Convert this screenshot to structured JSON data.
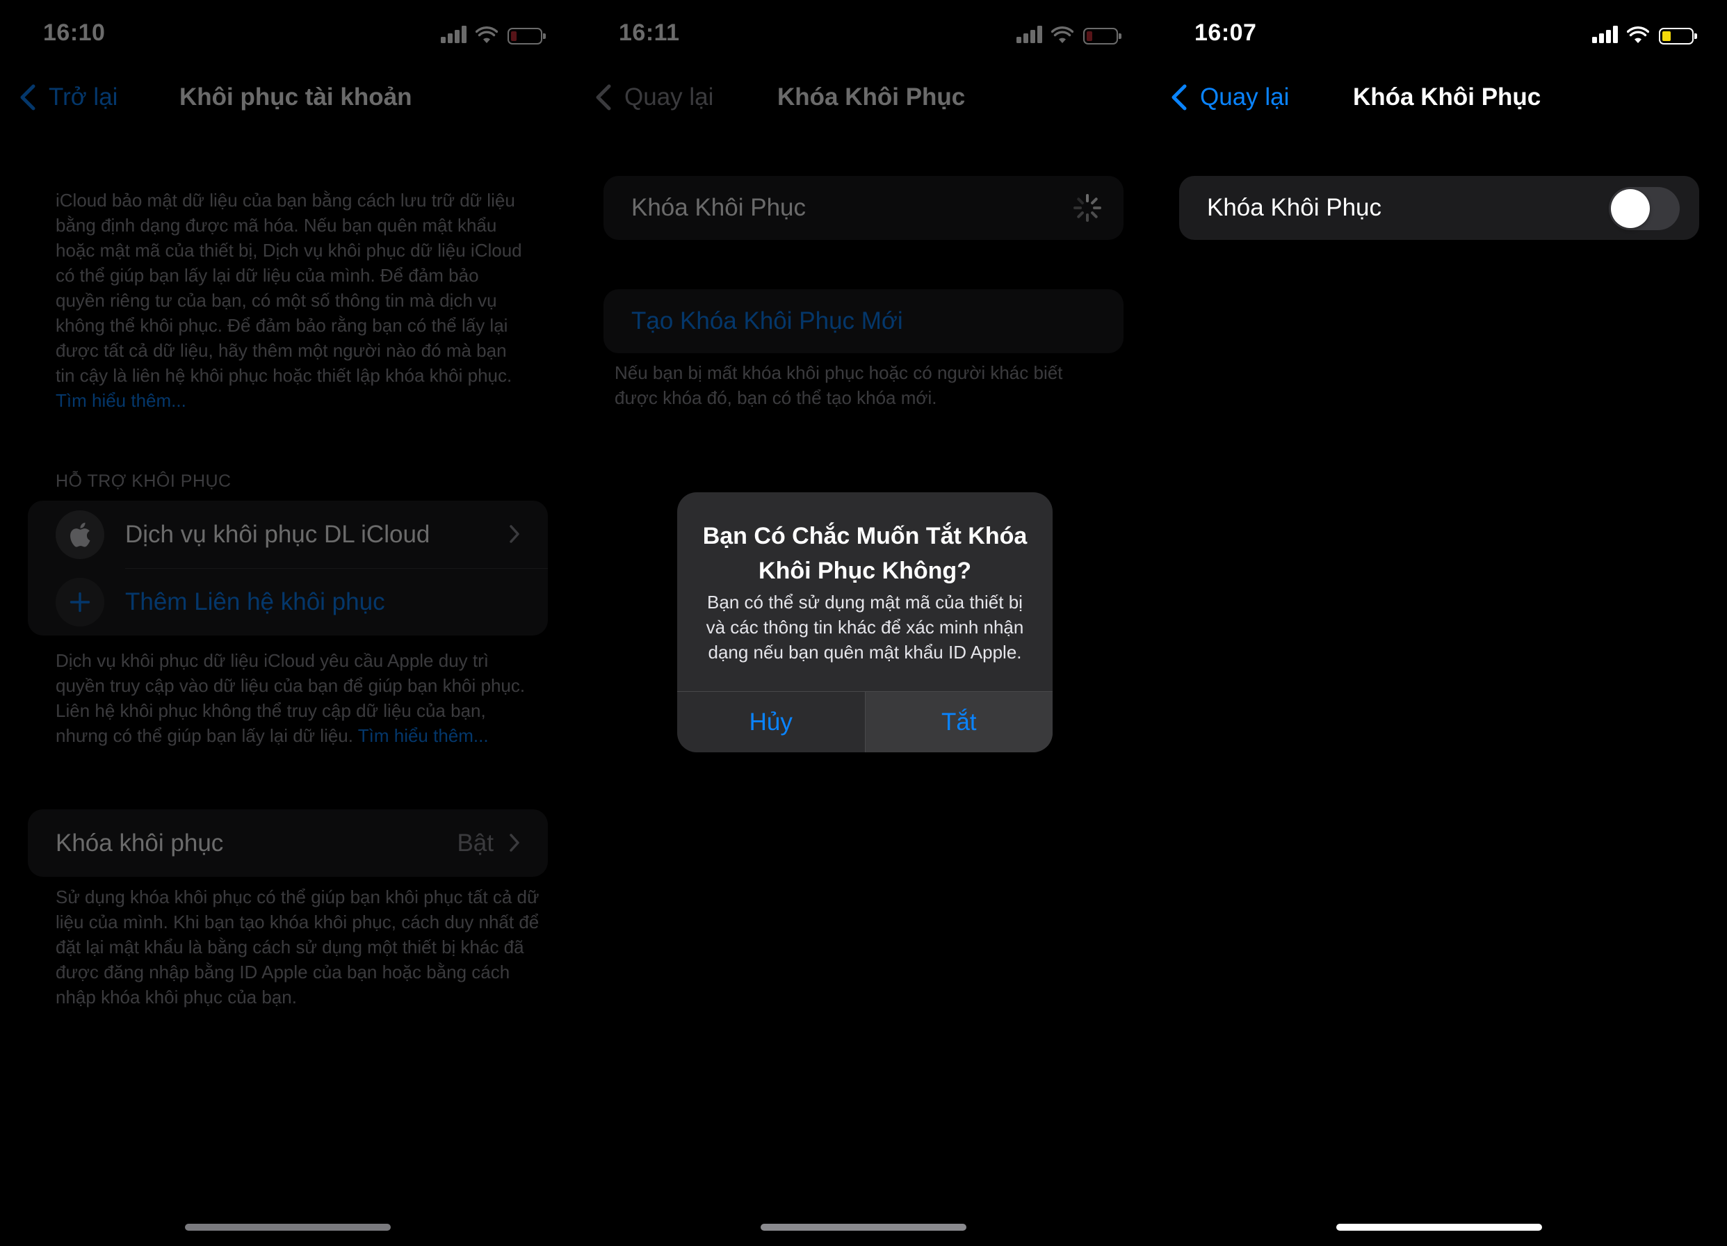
{
  "screens": [
    {
      "time": "16:10",
      "battery_color": "#d0303b",
      "back_label": "Trở lại",
      "title": "Khôi phục tài khoản",
      "intro_text": "iCloud bảo mật dữ liệu của bạn bằng cách lưu trữ dữ liệu bằng định dạng được mã hóa. Nếu bạn quên mật khẩu hoặc mật mã của thiết bị, Dịch vụ khôi phục dữ liệu iCloud có thể giúp bạn lấy lại dữ liệu của mình. Để đảm bảo quyền riêng tư của bạn, có một số thông tin mà dịch vụ không thể khôi phục. Để đảm bảo rằng bạn có thể lấy lại được tất cả dữ liệu, hãy thêm một người nào đó mà bạn tin cậy là liên hệ khôi phục hoặc thiết lập khóa khôi phục.",
      "intro_link": "Tìm hiểu thêm...",
      "section_header": "HỖ TRỢ KHÔI PHỤC",
      "rows": [
        {
          "label": "Dịch vụ khôi phục DL iCloud",
          "icon": "apple-icon"
        },
        {
          "label": "Thêm Liên hệ khôi phục",
          "icon": "plus-icon"
        }
      ],
      "footer_text": "Dịch vụ khôi phục dữ liệu iCloud yêu cầu Apple duy trì quyền truy cập vào dữ liệu của bạn để giúp bạn khôi phục. Liên hệ khôi phục không thể truy cập dữ liệu của bạn, nhưng có thể giúp bạn lấy lại dữ liệu.",
      "footer_link": "Tìm hiểu thêm...",
      "recovery_key_label": "Khóa khôi phục",
      "recovery_key_value": "Bật",
      "recovery_key_desc": "Sử dụng khóa khôi phục có thể giúp bạn khôi phục tất cả dữ liệu của mình. Khi bạn tạo khóa khôi phục, cách duy nhất để đặt lại mật khẩu là bằng cách sử dụng một thiết bị khác đã được đăng nhập bằng ID Apple của bạn hoặc bằng cách nhập khóa khôi phục của bạn."
    },
    {
      "time": "16:11",
      "battery_color": "#d0303b",
      "back_label": "Quay lại",
      "title": "Khóa Khôi Phục",
      "row_label": "Khóa Khôi Phục",
      "create_label": "Tạo Khóa Khôi Phục Mới",
      "create_desc": "Nếu bạn bị mất khóa khôi phục hoặc có người khác biết được khóa đó, bạn có thể tạo khóa mới.",
      "alert": {
        "title": "Bạn Có Chắc Muốn Tắt Khóa Khôi Phục Không?",
        "message": "Bạn có thể sử dụng mật mã của thiết bị và các thông tin khác để xác minh nhận dạng nếu bạn quên mật khẩu ID Apple.",
        "cancel": "Hủy",
        "confirm": "Tắt"
      }
    },
    {
      "time": "16:07",
      "battery_color": "#f5d90a",
      "back_label": "Quay lại",
      "title": "Khóa Khôi Phục",
      "toggle_label": "Khóa Khôi Phục",
      "toggle_on": false
    }
  ],
  "colors": {
    "accent": "#0a84ff",
    "background": "#000000",
    "cell": "#1c1c1e",
    "secondary_text": "#8e8e93"
  }
}
